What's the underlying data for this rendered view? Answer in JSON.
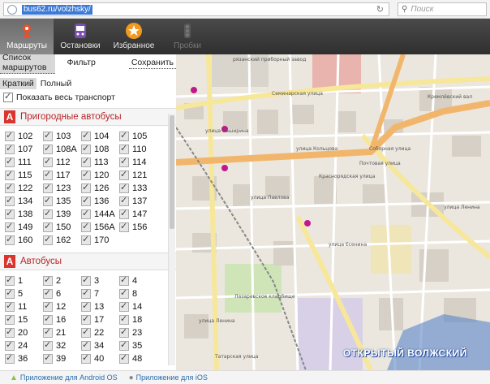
{
  "browser": {
    "url": "bus62.ru/volzhsky/",
    "search_placeholder": "Поиск"
  },
  "toolbar": {
    "buttons": [
      {
        "label": "Маршруты",
        "icon": "route-pin-icon"
      },
      {
        "label": "Остановки",
        "icon": "bus-stop-icon"
      },
      {
        "label": "Избранное",
        "icon": "star-icon"
      },
      {
        "label": "Пробки",
        "icon": "traffic-light-icon"
      }
    ]
  },
  "panel": {
    "tabs": [
      "Список маршрутов",
      "Фильтр",
      "Сохранить"
    ],
    "modes": [
      "Краткий",
      "Полный"
    ],
    "show_all": "Показать весь транспорт",
    "sections": [
      {
        "badge": "А",
        "title": "Пригородные автобусы",
        "routes": [
          "102",
          "103",
          "104",
          "105",
          "107",
          "108А",
          "108",
          "110",
          "111",
          "112",
          "113",
          "114",
          "115",
          "117",
          "120",
          "121",
          "122",
          "123",
          "126",
          "133",
          "134",
          "135",
          "136",
          "137",
          "138",
          "139",
          "144А",
          "147",
          "149",
          "150",
          "156А",
          "156",
          "160",
          "162",
          "170"
        ]
      },
      {
        "badge": "А",
        "title": "Автобусы",
        "routes": [
          "1",
          "2",
          "3",
          "4",
          "5",
          "6",
          "7",
          "8",
          "11",
          "12",
          "13",
          "14",
          "15",
          "16",
          "17",
          "18",
          "20",
          "21",
          "22",
          "23",
          "24",
          "32",
          "34",
          "35",
          "36",
          "39",
          "40",
          "48"
        ]
      }
    ]
  },
  "map": {
    "street_labels": [
      "рязанский приборный завод",
      "Семинарская улица",
      "Кремлёвский вал",
      "Соборная улица",
      "улица Ленина",
      "улица Каширина",
      "улица Кольцова",
      "Почтовая улица",
      "Краснорядская улица",
      "улица Павлова",
      "улица Есенина",
      "Лазаревское кладбище",
      "улица Ленина",
      "Татарская улица"
    ],
    "watermark": "ОТКРЫТЫЙ ВОЛЖСКИЙ"
  },
  "footer": {
    "android_link": "Приложение для Android OS",
    "ios_link": "Приложение для iOS"
  }
}
